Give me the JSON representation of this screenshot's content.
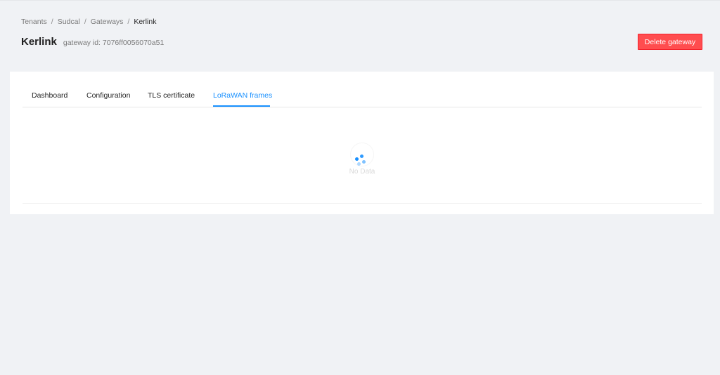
{
  "breadcrumb": {
    "items": [
      "Tenants",
      "Sudcal",
      "Gateways",
      "Kerlink"
    ],
    "separator": "/"
  },
  "page": {
    "title": "Kerlink",
    "subtitle": "gateway id: 7076ff0056070a51"
  },
  "actions": {
    "delete_label": "Delete gateway"
  },
  "tabs": [
    {
      "label": "Dashboard",
      "active": false
    },
    {
      "label": "Configuration",
      "active": false
    },
    {
      "label": "TLS certificate",
      "active": false
    },
    {
      "label": "LoRaWAN frames",
      "active": true
    }
  ],
  "content": {
    "empty_text": "No Data",
    "loading": true
  },
  "colors": {
    "accent": "#1890ff",
    "danger": "#ff4d4f",
    "background": "#f0f2f5"
  }
}
